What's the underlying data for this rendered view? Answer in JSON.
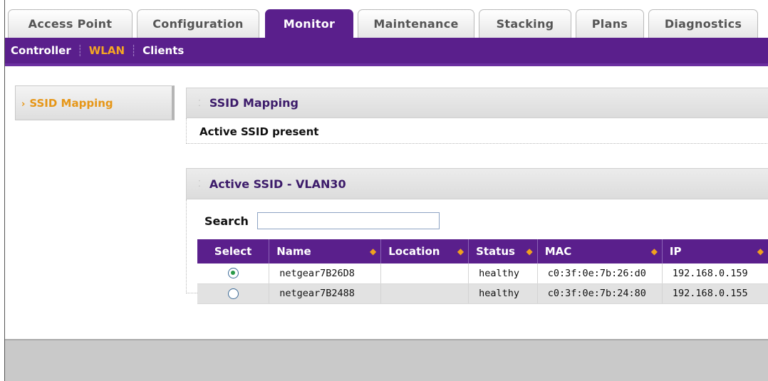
{
  "tabs": [
    {
      "label": "Access Point",
      "active": false
    },
    {
      "label": "Configuration",
      "active": false
    },
    {
      "label": "Monitor",
      "active": true
    },
    {
      "label": "Maintenance",
      "active": false
    },
    {
      "label": "Stacking",
      "active": false
    },
    {
      "label": "Plans",
      "active": false
    },
    {
      "label": "Diagnostics",
      "active": false
    }
  ],
  "subnav": {
    "items": [
      "Controller",
      "WLAN",
      "Clients"
    ],
    "selected": "WLAN"
  },
  "leftnav": {
    "item": "SSID Mapping"
  },
  "ssid_mapping": {
    "title": "SSID Mapping",
    "message": "Active SSID present"
  },
  "active_ssid": {
    "title": "Active SSID - VLAN30",
    "search_label": "Search",
    "search_value": "",
    "columns": [
      "Select",
      "Name",
      "Location",
      "Status",
      "MAC",
      "IP"
    ],
    "rows": [
      {
        "selected": true,
        "name": "netgear7B26D8",
        "location": "",
        "status": "healthy",
        "mac": "c0:3f:0e:7b:26:d0",
        "ip": "192.168.0.159"
      },
      {
        "selected": false,
        "name": "netgear7B2488",
        "location": "",
        "status": "healthy",
        "mac": "c0:3f:0e:7b:24:80",
        "ip": "192.168.0.155"
      }
    ]
  },
  "colors": {
    "brand_purple": "#5a1f8c",
    "accent_orange": "#f5a623"
  },
  "icons": {
    "sort": "sort-arrows-icon",
    "nav_arrow": "chevron-right-icon",
    "radio": "radio-button-icon"
  }
}
